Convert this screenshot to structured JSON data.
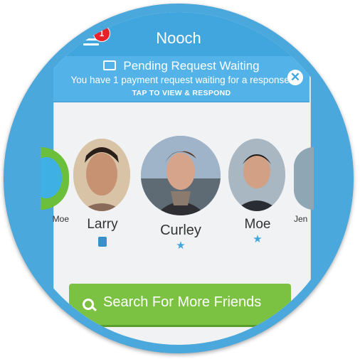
{
  "header": {
    "title": "Nooch",
    "notification_count": "1"
  },
  "banner": {
    "title": "Pending Request Waiting",
    "message": "You have 1 payment request waiting for a response.",
    "cta": "TAP TO VIEW & RESPOND",
    "close_glyph": "✕"
  },
  "friends": [
    {
      "name": "Moe",
      "partial": true
    },
    {
      "name": "Larry",
      "badge": "mail-icon"
    },
    {
      "name": "Curley",
      "badge": "star-icon"
    },
    {
      "name": "Moe",
      "badge": "star-icon"
    },
    {
      "name": "Jen",
      "partial": true
    }
  ],
  "search_button": {
    "label": "Search For More Friends"
  },
  "colors": {
    "brand_blue": "#41a6dd",
    "search_green": "#7cc242",
    "badge_red": "#e8222a"
  }
}
